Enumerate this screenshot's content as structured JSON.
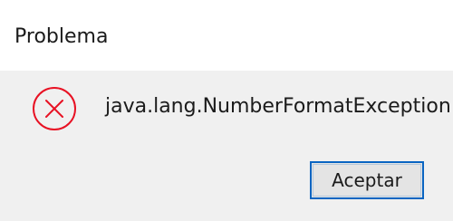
{
  "dialog": {
    "title": "Problema",
    "message": "java.lang.NumberFormatException",
    "icon": "error-icon",
    "ok_label": "Aceptar"
  },
  "colors": {
    "icon_red": "#e81123",
    "button_border": "#0a65c2",
    "body_bg": "#f0f0f0",
    "title_bg": "#ffffff"
  }
}
